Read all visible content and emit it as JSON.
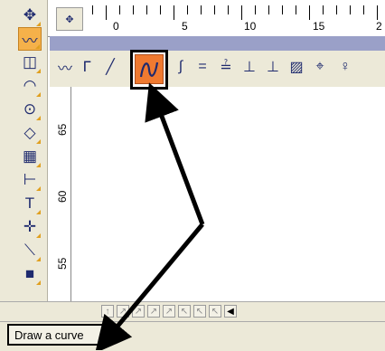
{
  "ruler": {
    "corner_icon": "move-icon",
    "h_labels": [
      "0",
      "5",
      "10",
      "15",
      "2"
    ],
    "v_labels": [
      "65",
      "60",
      "55"
    ]
  },
  "left_toolbar": {
    "tools": [
      {
        "name": "move-tool",
        "icon": "move-icon",
        "glyph": "✥"
      },
      {
        "name": "polyline-tool",
        "icon": "polyline-icon",
        "glyph": "〰",
        "active": true
      },
      {
        "name": "solid-tool",
        "icon": "cube-icon",
        "glyph": "◫"
      },
      {
        "name": "arc-tool",
        "icon": "arc-icon",
        "glyph": "◠"
      },
      {
        "name": "circle-tool",
        "icon": "circle-icon",
        "glyph": "⊙"
      },
      {
        "name": "shape-tool",
        "icon": "diamond-icon",
        "glyph": "◇"
      },
      {
        "name": "grid-tool",
        "icon": "grid-icon",
        "glyph": "▦"
      },
      {
        "name": "dimension-tool",
        "icon": "dimension-icon",
        "glyph": "⊢"
      },
      {
        "name": "text-tool",
        "icon": "text-icon",
        "glyph": "T"
      },
      {
        "name": "point-tool",
        "icon": "crosshair-icon",
        "glyph": "✛"
      },
      {
        "name": "line-tool",
        "icon": "line-icon",
        "glyph": "⟍"
      },
      {
        "name": "fill-tool",
        "icon": "fill-square-icon",
        "glyph": "■"
      }
    ]
  },
  "curve_toolbar": {
    "tools": [
      {
        "name": "polyline-icon",
        "glyph": "〰"
      },
      {
        "name": "step-line-icon",
        "glyph": "ᒥ"
      },
      {
        "name": "line-segment-icon",
        "glyph": "╱"
      },
      {
        "name": "curve-icon",
        "glyph": "∿",
        "active": true
      },
      {
        "name": "spline-icon",
        "glyph": "∫"
      },
      {
        "name": "parallel-icon",
        "glyph": "="
      },
      {
        "name": "offset-icon",
        "glyph": "≟"
      },
      {
        "name": "perpendicular-icon",
        "glyph": "⊥"
      },
      {
        "name": "perp-query-icon",
        "glyph": "⊥"
      },
      {
        "name": "hatch-icon",
        "glyph": "▨"
      },
      {
        "name": "center-icon",
        "glyph": "⌖"
      },
      {
        "name": "pin-icon",
        "glyph": "♀"
      }
    ]
  },
  "bottom_strip": {
    "buttons": [
      "↑",
      "↗",
      "↗",
      "↗",
      "↗",
      "↖",
      "↖",
      "↖",
      "◀"
    ]
  },
  "status": {
    "text": "Draw a curve"
  }
}
